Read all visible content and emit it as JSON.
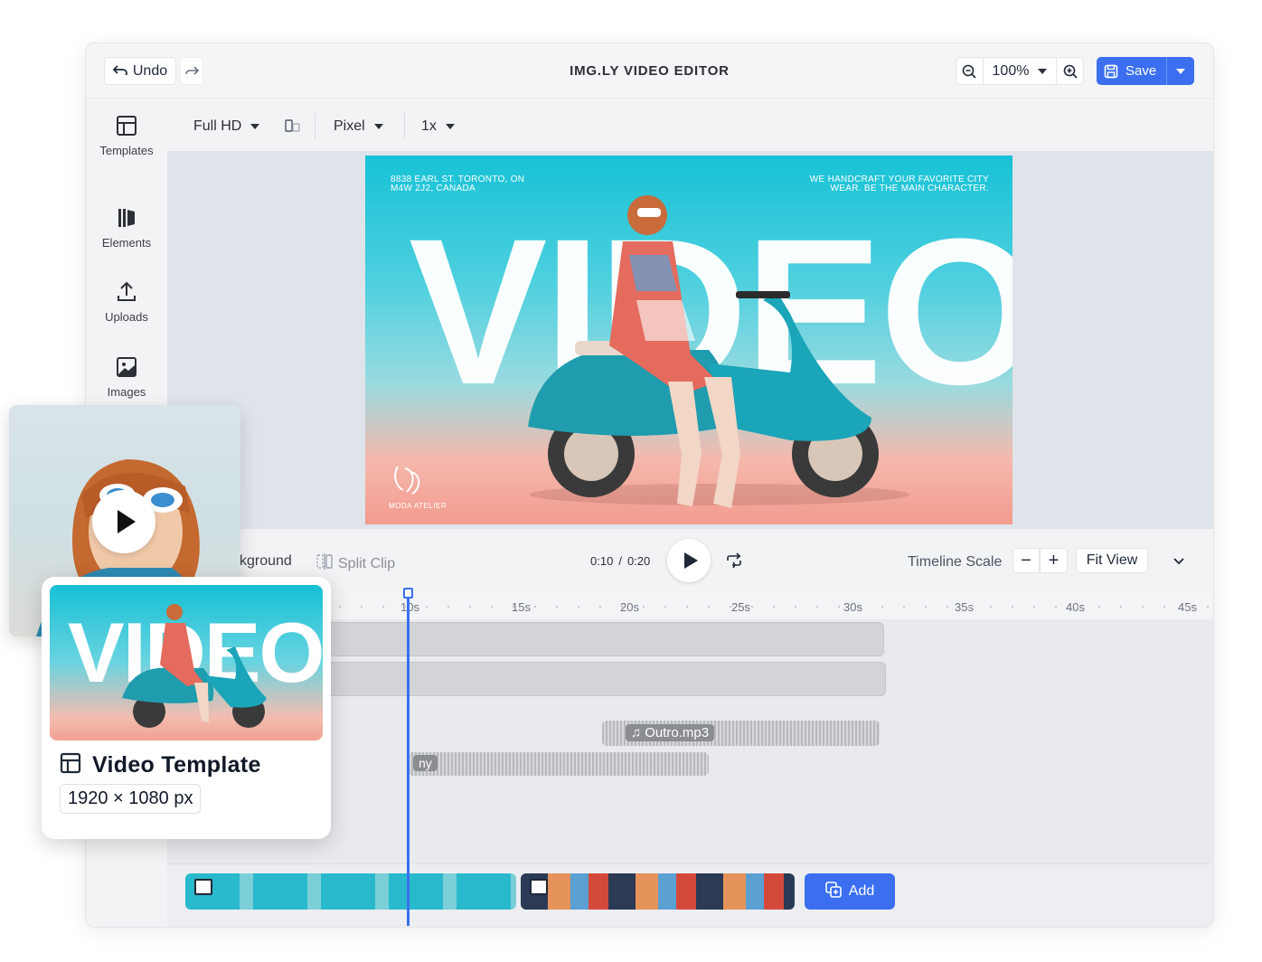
{
  "topbar": {
    "undo_label": "Undo",
    "title": "IMG.LY VIDEO EDITOR",
    "zoom": "100%",
    "save_label": "Save"
  },
  "sidebar": {
    "items": [
      {
        "label": "Templates",
        "icon": "template-icon"
      },
      {
        "label": "Elements",
        "icon": "elements-icon"
      },
      {
        "label": "Uploads",
        "icon": "upload-icon"
      },
      {
        "label": "Images",
        "icon": "image-icon"
      }
    ]
  },
  "canvas_toolbar": {
    "format": "Full HD",
    "unit": "Pixel",
    "scale": "1x"
  },
  "preview": {
    "address": "8838 EARL ST. TORONTO, ON M4W 2J2, CANADA",
    "tagline": "WE HANDCRAFT YOUR FAVORITE CITY WEAR. BE THE MAIN CHARACTER.",
    "headline": "VIDEO",
    "brand": "MODA ATELIER"
  },
  "controls": {
    "background_label": "kground",
    "split_label": "Split Clip",
    "current_time": "0:10",
    "separator": "/",
    "total_time": "0:20",
    "timeline_scale_label": "Timeline Scale",
    "fit_view_label": "Fit View"
  },
  "ruler": {
    "ticks": [
      "10s",
      "15s",
      "20s",
      "25s",
      "30s",
      "35s",
      "40s",
      "45s"
    ]
  },
  "tracks": {
    "audio1": "Outro.mp3",
    "audio2": "ny"
  },
  "bottom": {
    "add_label": "Add"
  },
  "template_card": {
    "title": "Video Template",
    "size": "1920 × 1080 px",
    "headline": "VIDEO"
  },
  "colors": {
    "accent": "#3b6ff0",
    "preview_top": "#17c2d6",
    "preview_bottom": "#f39b8e"
  }
}
